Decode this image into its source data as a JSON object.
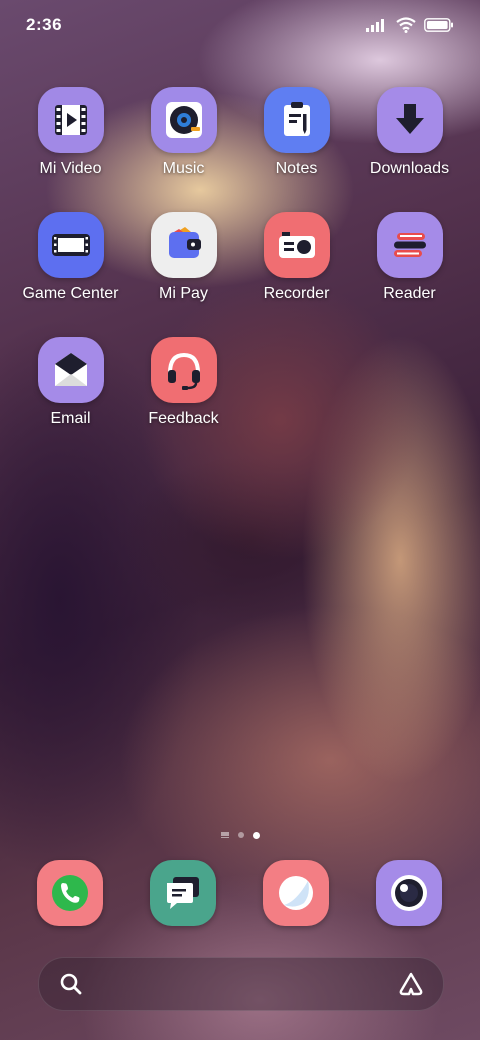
{
  "status_bar": {
    "time": "2:36",
    "icons": [
      "signal-icon",
      "wifi-icon",
      "battery-icon"
    ]
  },
  "apps": [
    {
      "label": "Mi Video",
      "icon": "mi-video-icon",
      "color": "#a189e6"
    },
    {
      "label": "Music",
      "icon": "music-icon",
      "color": "#a08ae8"
    },
    {
      "label": "Notes",
      "icon": "notes-icon",
      "color": "#5f7ef2"
    },
    {
      "label": "Downloads",
      "icon": "downloads-icon",
      "color": "#a58be8"
    },
    {
      "label": "Game Center",
      "icon": "game-center-icon",
      "color": "#5d6ff0"
    },
    {
      "label": "Mi Pay",
      "icon": "mi-pay-icon",
      "color": "#eeeeee"
    },
    {
      "label": "Recorder",
      "icon": "recorder-icon",
      "color": "#f06e72"
    },
    {
      "label": "Reader",
      "icon": "reader-icon",
      "color": "#a58be8"
    },
    {
      "label": "Email",
      "icon": "email-icon",
      "color": "#a58be8"
    },
    {
      "label": "Feedback",
      "icon": "feedback-icon",
      "color": "#f06e72"
    }
  ],
  "page_indicator": {
    "pages": 2,
    "active_page": 2
  },
  "dock": [
    {
      "icon": "phone-icon",
      "color": "#f37e84"
    },
    {
      "icon": "messages-icon",
      "color": "#4aa58c"
    },
    {
      "icon": "browser-icon",
      "color": "#f37e84"
    },
    {
      "icon": "camera-icon",
      "color": "#a58be8"
    }
  ],
  "search_bar": {
    "icon": "search-icon",
    "assistant_icon": "assistant-icon"
  }
}
